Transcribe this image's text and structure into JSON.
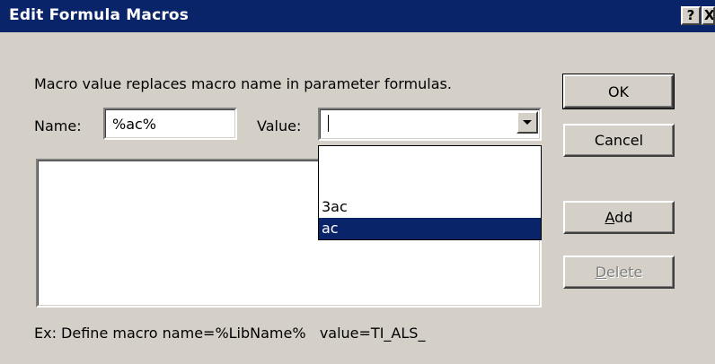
{
  "window": {
    "title": "Edit Formula Macros",
    "help_glyph": "?",
    "close_glyph": "X"
  },
  "description": "Macro value replaces macro name in parameter formulas.",
  "name_field": {
    "label": "Name:",
    "value": "%ac%"
  },
  "value_field": {
    "label": "Value:",
    "value": ""
  },
  "dropdown": {
    "options": [
      "",
      "",
      "3ac",
      "ac"
    ],
    "selected": "ac"
  },
  "buttons": {
    "ok": "OK",
    "cancel": "Cancel",
    "add_mnemonic": "A",
    "add_rest": "dd",
    "delete_mnemonic": "D",
    "delete_rest": "elete"
  },
  "example": "Ex: Define macro name=%LibName%   value=TI_ALS_"
}
